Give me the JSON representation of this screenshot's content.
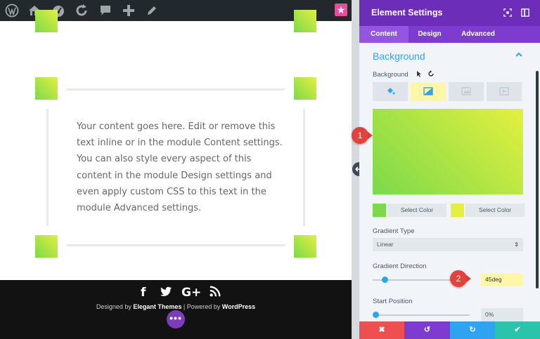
{
  "admin_bar": {
    "icons": [
      "wordpress-logo-icon",
      "home-icon",
      "dashboard-icon",
      "refresh-icon",
      "comment-icon",
      "plus-icon",
      "pencil-icon",
      "divi-star-icon"
    ],
    "star_glyph": "★"
  },
  "content": {
    "body_text": "Your content goes here. Edit or remove this text inline or in the module Content settings. You can also style every aspect of this content in the module Design settings and even apply custom CSS to this text in the module Advanced settings."
  },
  "footer": {
    "social": [
      "f",
      "twitter",
      "G+",
      "rss"
    ],
    "credits_prefix": "Designed by ",
    "credits_brand": "Elegant Themes",
    "credits_mid": " | Powered by ",
    "credits_wp": "WordPress",
    "dots_glyph": "•••"
  },
  "panel": {
    "title": "Element Settings",
    "tabs": [
      "Content",
      "Design",
      "Advanced"
    ],
    "active_tab": "Content",
    "section_title": "Background",
    "background_label": "Background",
    "background_types": [
      "color-icon",
      "gradient-icon",
      "image-icon",
      "video-icon"
    ],
    "active_background_type": "gradient-icon",
    "gradient": {
      "start_color": "#7bd94a",
      "end_color": "#e3f03f",
      "select_color_label": "Select Color",
      "type_label": "Gradient Type",
      "type_value": "Linear",
      "direction_label": "Gradient Direction",
      "direction_value": "45deg",
      "direction_fraction": 0.125,
      "start_position_label": "Start Position",
      "start_position_value": "0%",
      "start_position_fraction": 0.0
    },
    "callouts": [
      "1",
      "2"
    ]
  },
  "actions": {
    "cancel_glyph": "✖",
    "undo_glyph": "↺",
    "redo_glyph": "↻",
    "save_glyph": "✔"
  },
  "colors": {
    "admin_bar": "#23282d",
    "panel_header": "#6c2eb9",
    "accent_blue": "#2ea3f2",
    "cancel": "#ef4f4f",
    "undo": "#7e3bd0",
    "redo": "#2ea3f2",
    "save": "#29c4a9",
    "callout": "#e5413b"
  }
}
